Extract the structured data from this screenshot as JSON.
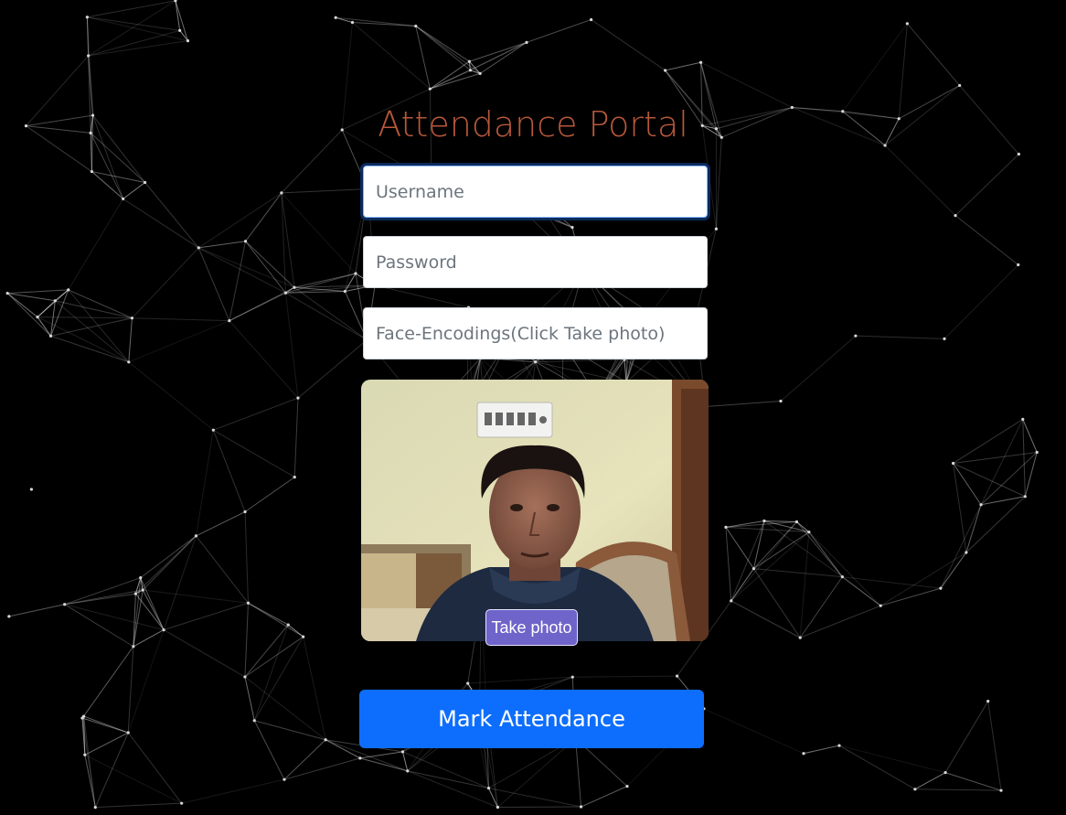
{
  "page": {
    "title": "Attendance Portal",
    "title_color": "#b9583a",
    "background_color": "#000000"
  },
  "form": {
    "username": {
      "placeholder": "Username",
      "value": ""
    },
    "password": {
      "placeholder": "Password",
      "value": ""
    },
    "face_encodings": {
      "placeholder": "Face-Encodings(Click Take photo)",
      "value": ""
    }
  },
  "camera": {
    "take_photo_label": "Take photo",
    "take_photo_color": "#6f64c9"
  },
  "submit": {
    "label": "Mark Attendance",
    "color": "#0d6efd"
  }
}
